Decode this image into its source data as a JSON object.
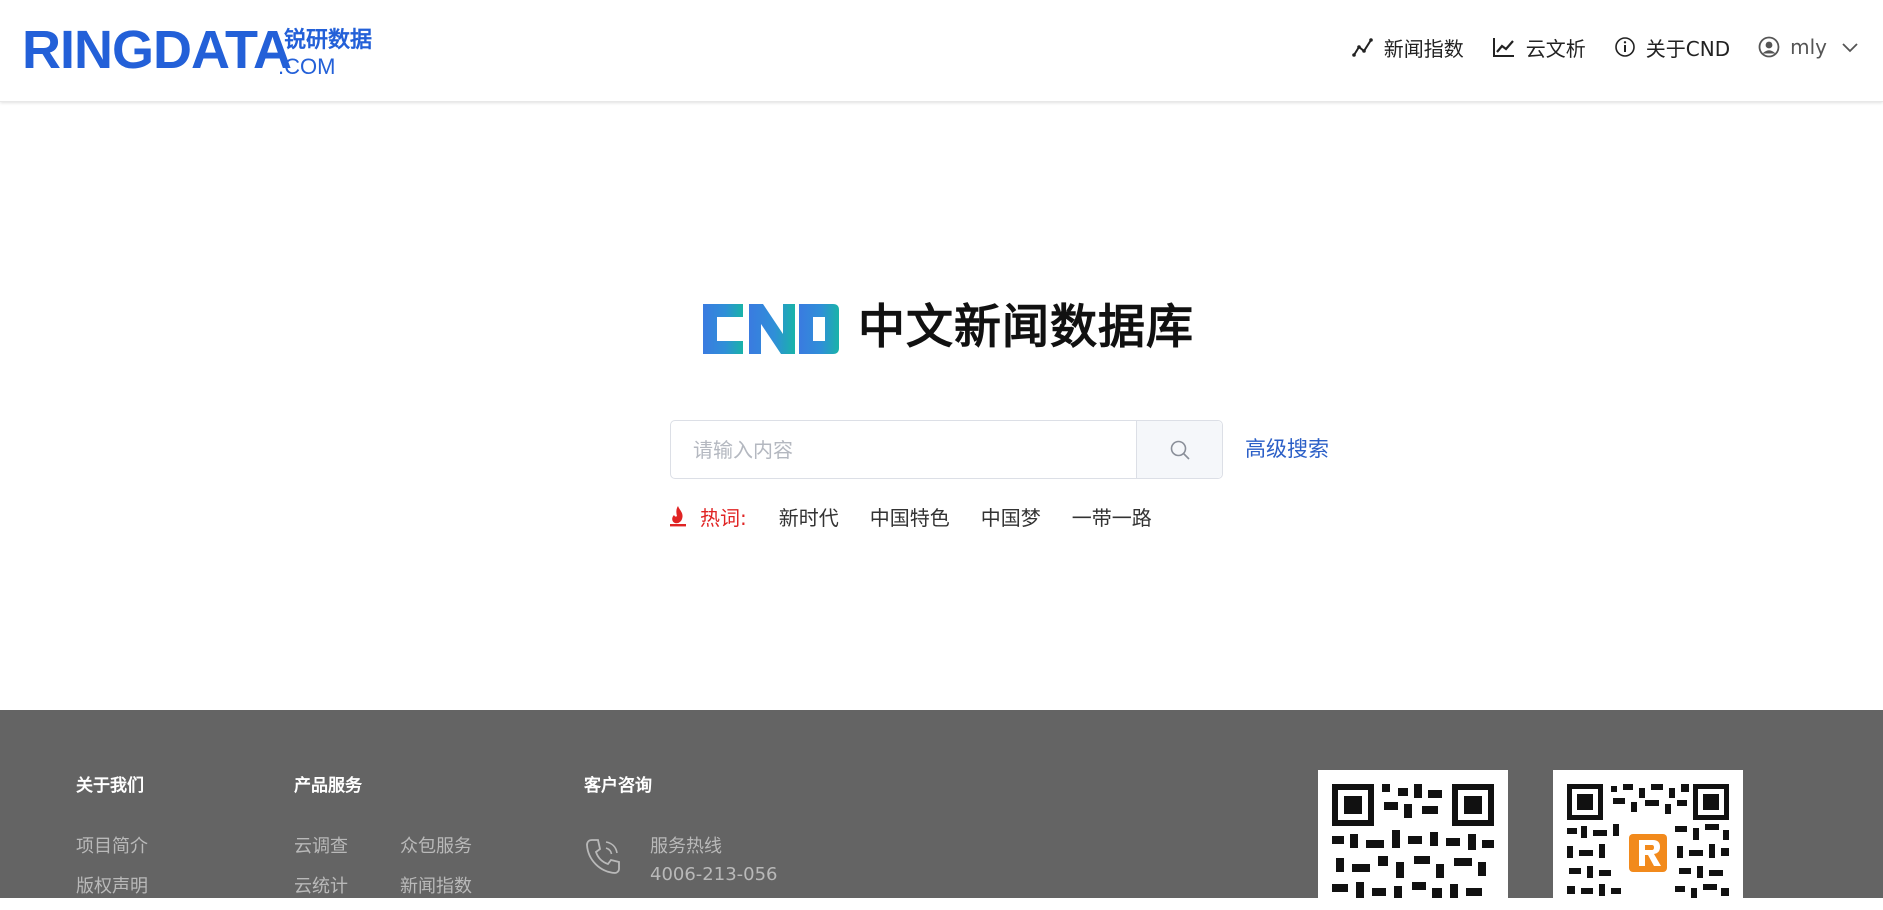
{
  "header": {
    "brand_main": "RINGDATA",
    "brand_cn": "锐研数据",
    "brand_com": ".COM",
    "nav": [
      {
        "label": "新闻指数",
        "icon": "line-chart-icon"
      },
      {
        "label": "云文析",
        "icon": "trend-chart-icon"
      },
      {
        "label": "关于CND",
        "icon": "info-icon"
      }
    ],
    "user": {
      "name": "mly",
      "icon": "user-avatar-icon"
    }
  },
  "main": {
    "logo_text": "CND",
    "title": "中文新闻数据库",
    "search": {
      "placeholder": "请输入内容",
      "value": ""
    },
    "advanced_search": "高级搜索",
    "hot": {
      "label": "热词:",
      "words": [
        "新时代",
        "中国特色",
        "中国梦",
        "一带一路"
      ]
    }
  },
  "footer": {
    "about": {
      "title": "关于我们",
      "links": [
        "项目简介",
        "版权声明"
      ]
    },
    "products": {
      "title": "产品服务",
      "links": [
        "云调查",
        "众包服务",
        "云统计",
        "新闻指数"
      ]
    },
    "contact": {
      "title": "客户咨询",
      "hotline_label": "服务热线",
      "hotline": "4006-213-056"
    }
  },
  "colors": {
    "brand_blue": "#2360d8",
    "link_blue": "#2b5fc7",
    "hot_red": "#e02424",
    "footer_bg": "#646464"
  }
}
